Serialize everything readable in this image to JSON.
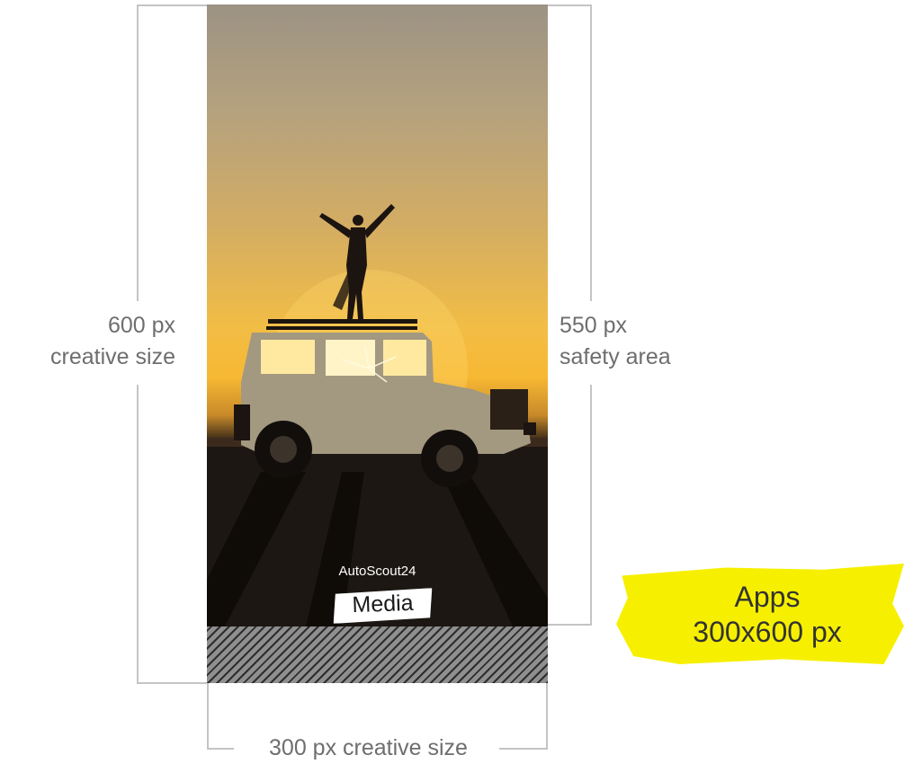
{
  "left_label": {
    "line1": "600 px",
    "line2": "creative size"
  },
  "right_label": {
    "line1": "550 px",
    "line2": "safety area"
  },
  "bottom_label": "300 px creative size",
  "creative": {
    "brand_small": "AutoScout24",
    "brand_large": "Media"
  },
  "badge": {
    "line1": "Apps",
    "line2": "300x600 px"
  },
  "colors": {
    "badge": "#f6f000",
    "lines": "#c4c4c4",
    "label_text": "#6e6e6e"
  }
}
